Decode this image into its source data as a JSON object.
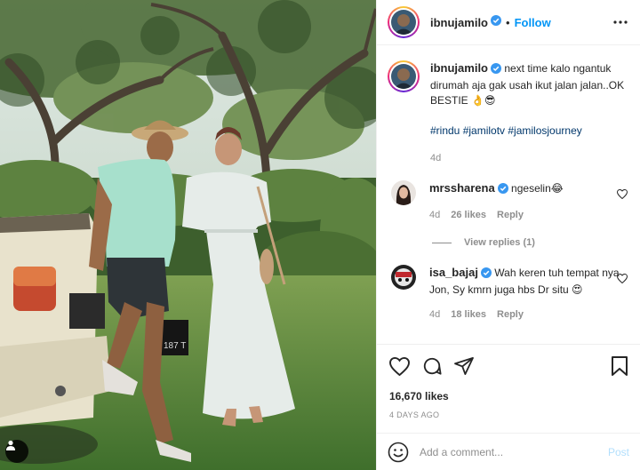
{
  "photo": {
    "description_alt": "",
    "plate_text": "187 T",
    "tag_icon": "user-tag-icon"
  },
  "header": {
    "username": "ibnujamilo",
    "separator": "•",
    "follow_label": "Follow",
    "more_icon": "more-horizontal-icon"
  },
  "caption": {
    "username": "ibnujamilo",
    "text": " next time kalo ngantuk dirumah aja gak usah ikut jalan jalan..OK BESTIE 👌😎",
    "hashtags": "#rindu #jamilotv #jamilosjourney",
    "age": "4d"
  },
  "comments": [
    {
      "username": "mrssharena",
      "text": " ngeselin😂",
      "age": "4d",
      "likes": "26 likes",
      "reply_label": "Reply",
      "view_replies": "View replies (1)"
    },
    {
      "username": "isa_bajaj",
      "text": " Wah keren tuh tempat nya Jon, Sy kmrn juga hbs Dr situ 😍",
      "age": "4d",
      "likes": "18 likes",
      "reply_label": "Reply"
    }
  ],
  "actions": {
    "likes": "16,670 likes",
    "date": "4 DAYS AGO"
  },
  "add_comment": {
    "placeholder": "Add a comment...",
    "post_label": "Post"
  },
  "colors": {
    "accent": "#0095f6",
    "hashtag": "#00376b",
    "muted": "#8e8e8e",
    "verified": "#3897f0"
  }
}
